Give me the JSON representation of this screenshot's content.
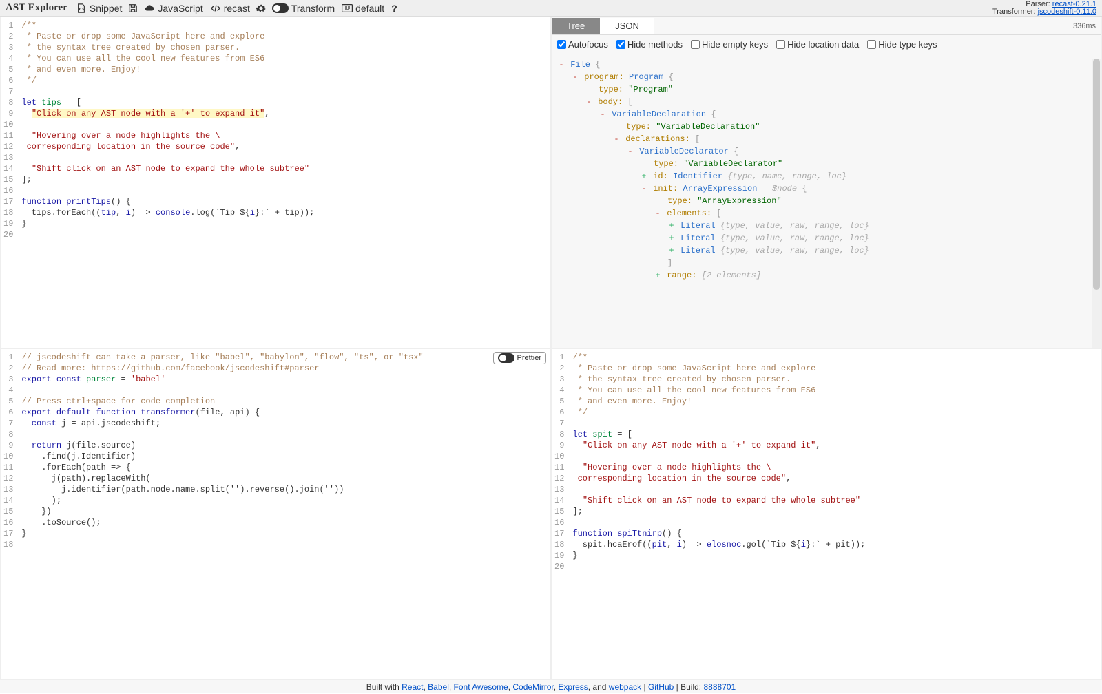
{
  "toolbar": {
    "title": "AST Explorer",
    "snippet": "Snippet",
    "lang": "JavaScript",
    "parser": "recast",
    "transform": "Transform",
    "keymap": "default",
    "meta_parser_label": "Parser: ",
    "meta_parser_link": "recast-0.21.1",
    "meta_transformer_label": "Transformer: ",
    "meta_transformer_link": "jscodeshift-0.11.0"
  },
  "source_lines": [
    "1",
    "2",
    "3",
    "4",
    "5",
    "6",
    "7",
    "8",
    "9",
    "10",
    "11",
    "12",
    "13",
    "14",
    "15",
    "16",
    "17",
    "18",
    "19",
    "20"
  ],
  "source_code": {
    "l1": "/**",
    "l2": " * Paste or drop some JavaScript here and explore",
    "l3": " * the syntax tree created by chosen parser.",
    "l4": " * You can use all the cool new features from ES6",
    "l5": " * and even more. Enjoy!",
    "l6": " */",
    "l8_let": "let",
    "l8_var": " tips",
    "l8_rest": " = [",
    "l9": "\"Click on any AST node with a '+' to expand it\"",
    "l9_comma": ",",
    "l11": "\"Hovering over a node highlights the \\",
    "l12": " corresponding location in the source code\"",
    "l12_comma": ",",
    "l14": "\"Shift click on an AST node to expand the whole subtree\"",
    "l15": "];",
    "l17_kw": "function",
    "l17_name": " printTips",
    "l17_rest": "() {",
    "l18a": "  tips.forEach((",
    "l18b": "tip",
    "l18c": ", ",
    "l18d": "i",
    "l18e": ") => ",
    "l18f": "console",
    "l18g": ".log(`Tip ${",
    "l18h": "i",
    "l18i": "}:` + tip));",
    "l19": "}"
  },
  "tree": {
    "tabs": {
      "tree": "Tree",
      "json": "JSON"
    },
    "time": "336ms",
    "opts": {
      "autofocus": "Autofocus",
      "hide_methods": "Hide methods",
      "hide_empty": "Hide empty keys",
      "hide_loc": "Hide location data",
      "hide_type": "Hide type keys"
    },
    "nodes": {
      "file": "File",
      "program_k": "program:",
      "program_v": "Program",
      "type_k": "type:",
      "type_program": "\"Program\"",
      "body_k": "body:",
      "vardecl": "VariableDeclaration",
      "type_vardecl": "\"VariableDeclaration\"",
      "declarations_k": "declarations:",
      "vardeclr": "VariableDeclarator",
      "type_vardeclr": "\"VariableDeclarator\"",
      "id_k": "id:",
      "id_v": "Identifier",
      "id_gray": "{type, name, range, loc}",
      "init_k": "init:",
      "init_v": "ArrayExpression",
      "init_anno": "= $node",
      "type_arrexp": "\"ArrayExpression\"",
      "elements_k": "elements:",
      "literal": "Literal",
      "literal_gray": "{type, value, raw, range, loc}",
      "range_k": "range:",
      "range_gray": "[2 elements]"
    }
  },
  "transform_lines": [
    "1",
    "2",
    "3",
    "4",
    "5",
    "6",
    "7",
    "8",
    "9",
    "10",
    "11",
    "12",
    "13",
    "14",
    "15",
    "16",
    "17",
    "18"
  ],
  "transform_code": {
    "l1": "// jscodeshift can take a parser, like \"babel\", \"babylon\", \"flow\", \"ts\", or \"tsx\"",
    "l2": "// Read more: https://github.com/facebook/jscodeshift#parser",
    "l3_exp": "export",
    "l3_const": " const",
    "l3_var": " parser",
    "l3_eq": " = ",
    "l3_str": "'babel'",
    "l5": "// Press ctrl+space for code completion",
    "l6_exp": "export",
    "l6_def": " default",
    "l6_fn": " function",
    "l6_name": " transformer",
    "l6_args": "(file, api) {",
    "l7": "  const j = api.jscodeshift;",
    "l7_const": "  const",
    "l7_rest": " j = api.jscodeshift;",
    "l9": "  return j(file.source)",
    "l9_ret": "  return",
    "l9_rest": " j(file.source)",
    "l10": "    .find(j.Identifier)",
    "l11": "    .forEach(path => {",
    "l12": "      j(path).replaceWith(",
    "l13": "        j.identifier(path.node.name.split('').reverse().join(''))",
    "l14": "      );",
    "l15": "    })",
    "l16": "    .toSource();",
    "l17": "}"
  },
  "prettier_label": "Prettier",
  "output_lines": [
    "1",
    "2",
    "3",
    "4",
    "5",
    "6",
    "7",
    "8",
    "9",
    "10",
    "11",
    "12",
    "13",
    "14",
    "15",
    "16",
    "17",
    "18",
    "19",
    "20"
  ],
  "output_code": {
    "l1": "/**",
    "l2": " * Paste or drop some JavaScript here and explore",
    "l3": " * the syntax tree created by chosen parser.",
    "l4": " * You can use all the cool new features from ES6",
    "l5": " * and even more. Enjoy!",
    "l6": " */",
    "l8_let": "let",
    "l8_var": " spit",
    "l8_rest": " = [",
    "l9": "\"Click on any AST node with a '+' to expand it\"",
    "l9_comma": ",",
    "l11": "\"Hovering over a node highlights the \\",
    "l12": " corresponding location in the source code\"",
    "l12_comma": ",",
    "l14": "\"Shift click on an AST node to expand the whole subtree\"",
    "l15": "];",
    "l17_kw": "function",
    "l17_name": " spiTtnirp",
    "l17_rest": "() {",
    "l18a": "  spit.hcaErof((",
    "l18b": "pit",
    "l18c": ", ",
    "l18d": "i",
    "l18e": ") => ",
    "l18f": "elosnoc",
    "l18g": ".gol(`Tip ${",
    "l18h": "i",
    "l18i": "}:` + pit));",
    "l19": "}"
  },
  "footer": {
    "prefix": "Built with ",
    "links": [
      "React",
      "Babel",
      "Font Awesome",
      "CodeMirror",
      "Express",
      "webpack",
      "GitHub"
    ],
    "and": ", and ",
    "sep": " | ",
    "build_label": "Build: ",
    "build": "8888701"
  }
}
